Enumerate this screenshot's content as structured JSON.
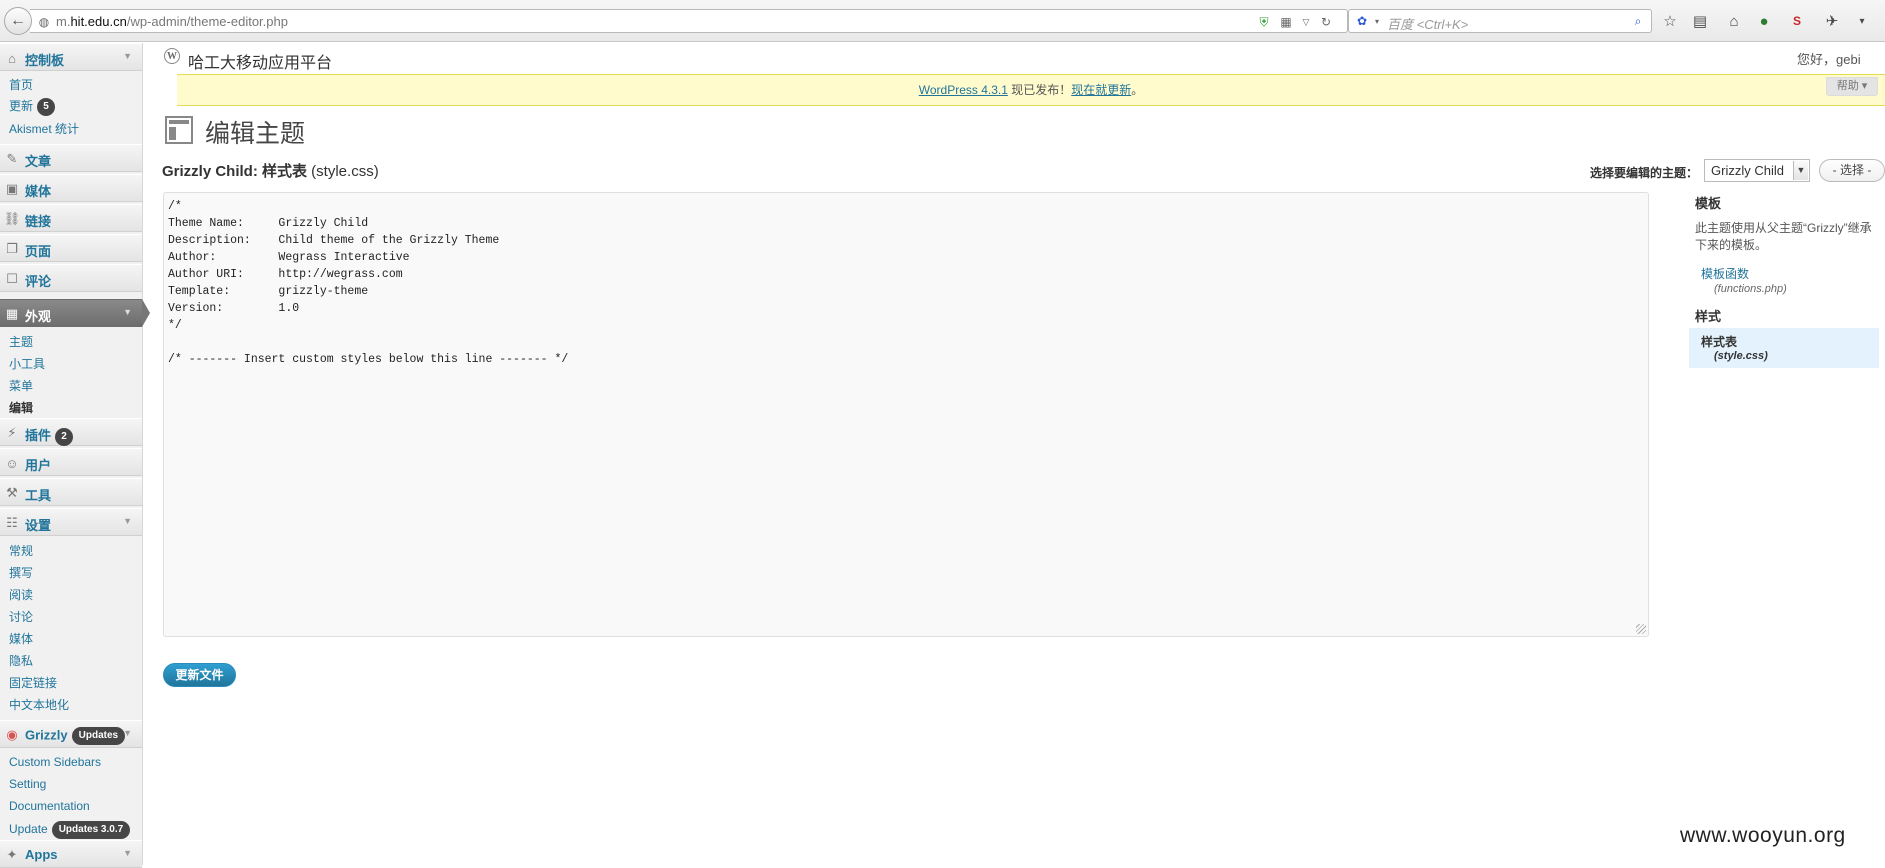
{
  "browser": {
    "url_prefix": "m.",
    "url_domain": "hit.edu.cn",
    "url_path": "/wp-admin/theme-editor.php",
    "search_placeholder": "百度 <Ctrl+K>"
  },
  "sidebar": {
    "dashboard": {
      "label": "控制板",
      "subs": [
        "首页",
        "更新",
        "Akismet 统计"
      ],
      "update_count": "5"
    },
    "posts": "文章",
    "media": "媒体",
    "links": "链接",
    "pages": "页面",
    "comments": "评论",
    "appearance": {
      "label": "外观",
      "subs": [
        "主题",
        "小工具",
        "菜单",
        "编辑"
      ]
    },
    "plugins": {
      "label": "插件",
      "count": "2"
    },
    "users": "用户",
    "tools": "工具",
    "settings": {
      "label": "设置",
      "subs": [
        "常规",
        "撰写",
        "阅读",
        "讨论",
        "媒体",
        "隐私",
        "固定链接",
        "中文本地化"
      ]
    },
    "grizzly": {
      "label": "Grizzly",
      "badge": "Updates",
      "subs": [
        "Custom Sidebars",
        "Setting",
        "Documentation",
        "Update"
      ],
      "update_badge": "Updates 3.0.7"
    },
    "apps": "Apps"
  },
  "header": {
    "site_title": "哈工大移动应用平台",
    "howdy": "您好，gebi",
    "notice_link1": "WordPress 4.3.1",
    "notice_text": " 现已发布！",
    "notice_link2": "现在就更新",
    "notice_end": "。",
    "help": "帮助"
  },
  "main": {
    "heading": "编辑主题",
    "file_title_bold": "Grizzly Child: 样式表",
    "file_title_rest": " (style.css)",
    "select_label": "选择要编辑的主题：",
    "selected_theme": "Grizzly Child",
    "select_button": "选择",
    "code": "/*\nTheme Name:     Grizzly Child\nDescription:    Child theme of the Grizzly Theme\nAuthor:         Wegrass Interactive\nAuthor URI:     http://wegrass.com\nTemplate:       grizzly-theme\nVersion:        1.0\n*/\n\n/* ------- Insert custom styles below this line ------- */",
    "update_button": "更新文件"
  },
  "files_panel": {
    "templates_heading": "模板",
    "templates_desc": "此主题使用从父主题“Grizzly”继承下来的模板。",
    "functions_label": "模板函数",
    "functions_file": "(functions.php)",
    "styles_heading": "样式",
    "stylesheet_label": "样式表",
    "stylesheet_file": "(style.css)"
  },
  "watermark": "www.wooyun.org"
}
